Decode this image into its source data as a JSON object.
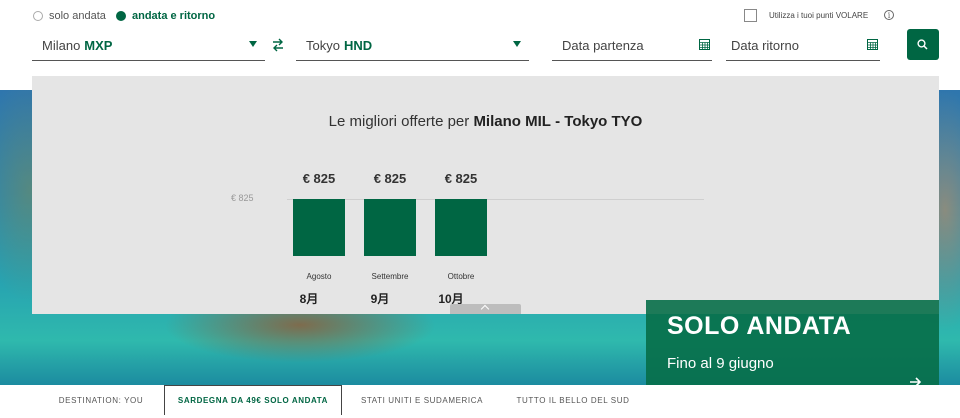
{
  "trip_type": {
    "one_way": "solo andata",
    "round_trip": "andata e ritorno",
    "selected": "round_trip"
  },
  "loyalty": {
    "label": "Utilizza i tuoi punti VOLARE"
  },
  "origin": {
    "city": "Milano",
    "code": "MXP"
  },
  "destination": {
    "city": "Tokyo",
    "code": "HND"
  },
  "dates": {
    "departure_placeholder": "Data partenza",
    "return_placeholder": "Data ritorno"
  },
  "offers": {
    "title_prefix": "Le migliori offerte per",
    "route_from": "Milano MIL",
    "route_sep": "-",
    "route_to": "Tokyo TYO"
  },
  "chart_data": {
    "type": "bar",
    "categories": [
      "Agosto",
      "Settembre",
      "Ottobre"
    ],
    "categories_secondary": [
      "8月",
      "9月",
      "10月"
    ],
    "values": [
      825,
      825,
      825
    ],
    "value_labels": [
      "€ 825",
      "€ 825",
      "€ 825"
    ],
    "y_tick_label": "€ 825",
    "ylim": [
      0,
      825
    ],
    "grid": true,
    "colors": {
      "bar": "#006643"
    }
  },
  "promo": {
    "title": "SOLO ANDATA",
    "subtitle": "Fino al 9 giugno"
  },
  "tabs": [
    {
      "label": "DESTINATION: YOU"
    },
    {
      "label": "SARDEGNA DA 49€ SOLO ANDATA"
    },
    {
      "label": "STATI UNITI E SUDAMERICA"
    },
    {
      "label": "TUTTO IL BELLO DEL SUD"
    }
  ],
  "colors": {
    "brand": "#006643",
    "panel": "#e5e5e5"
  },
  "icons": {
    "swap": "swap-arrows-icon",
    "calendar": "calendar-icon",
    "search": "search-icon",
    "info": "info-icon",
    "arrow": "arrow-right-icon"
  }
}
